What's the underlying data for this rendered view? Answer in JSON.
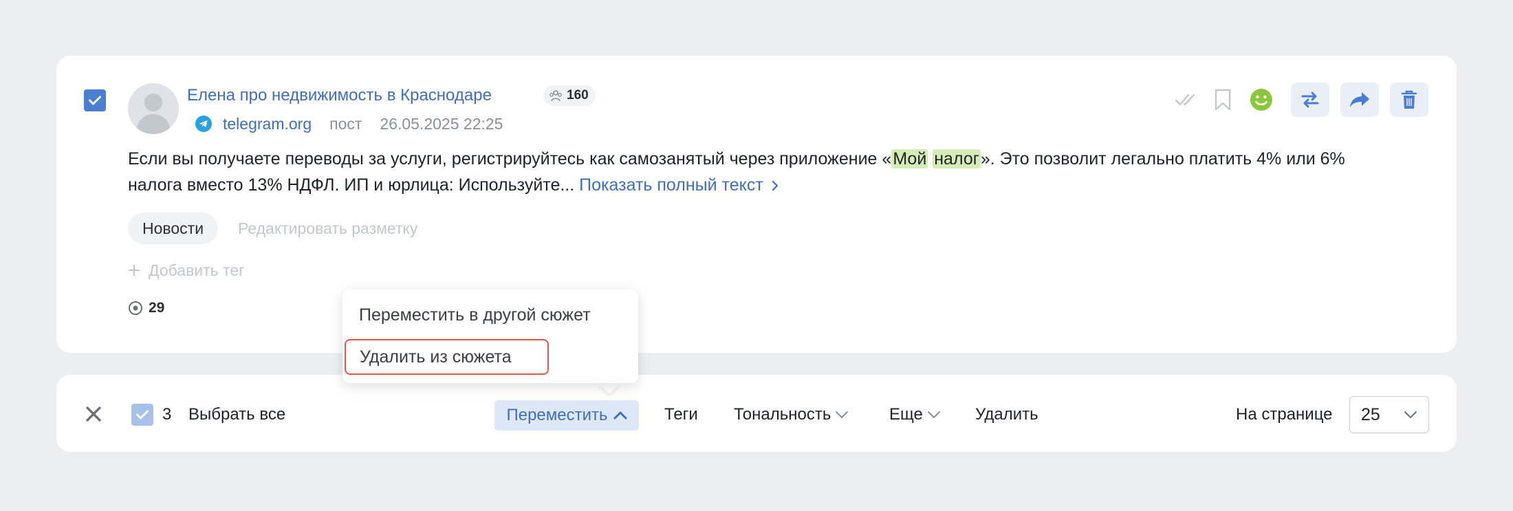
{
  "post": {
    "author": "Елена про недвижимость в Краснодаре",
    "subscribers": "160",
    "source": "telegram.org",
    "type": "пост",
    "date": "26.05.2025 22:25",
    "text_before": "Если вы получаете переводы за услуги, регистрируйтесь как самозанятый через приложение «",
    "highlight_1": "Мой",
    "highlight_2": "налог",
    "text_after": "». Это позволит легально платить 4% или 6% налога вместо 13% НДФЛ. ИП и юрлица: Используйте... ",
    "show_full": "Показать полный текст",
    "tag": "Новости",
    "edit_markup": "Редактировать разметку",
    "add_tag": "Добавить тег",
    "views": "29"
  },
  "actions": {
    "icons": [
      "check-icon",
      "bookmark-icon",
      "smile-icon",
      "transfer-icon",
      "share-icon",
      "trash-icon"
    ],
    "colors": {
      "accent": "#4a7ed0",
      "sentiment": "#8cc63f",
      "btn_bg": "#e9eef7"
    }
  },
  "bulk_bar": {
    "selected_count": "3",
    "select_all": "Выбрать все",
    "move": "Переместить",
    "tags": "Теги",
    "tonality": "Тональность",
    "more": "Еще",
    "delete": "Удалить",
    "per_page_label": "На странице",
    "per_page_value": "25"
  },
  "move_menu": {
    "items": [
      "Переместить в другой сюжет",
      "Удалить из сюжета"
    ]
  }
}
